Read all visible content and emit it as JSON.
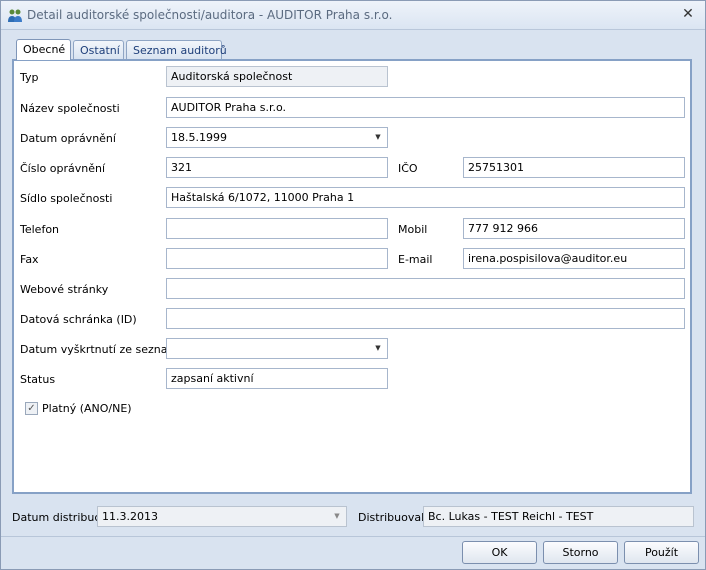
{
  "window": {
    "title": "Detail auditorské společnosti/auditora - AUDITOR Praha s.r.o.",
    "title_icon": "users-icon",
    "close_glyph": "✕"
  },
  "tabs": [
    {
      "label": "Obecné",
      "active": true
    },
    {
      "label": "Ostatní",
      "active": false
    },
    {
      "label": "Seznam auditorů",
      "active": false
    }
  ],
  "form": {
    "typ": {
      "label": "Typ",
      "value": "Auditorská společnost"
    },
    "nazev": {
      "label": "Název společnosti",
      "value": "AUDITOR Praha s.r.o."
    },
    "datum_opravneni": {
      "label": "Datum oprávnění",
      "value": "18.5.1999"
    },
    "cislo_opravneni": {
      "label": "Číslo oprávnění",
      "value": "321"
    },
    "ico": {
      "label": "IČO",
      "value": "25751301"
    },
    "sidlo": {
      "label": "Sídlo společnosti",
      "value": "Haštalská 6/1072, 11000  Praha 1"
    },
    "telefon": {
      "label": "Telefon",
      "value": ""
    },
    "mobil": {
      "label": "Mobil",
      "value": "777 912 966"
    },
    "fax": {
      "label": "Fax",
      "value": ""
    },
    "email": {
      "label": "E-mail",
      "value": "irena.pospisilova@auditor.eu"
    },
    "web": {
      "label": "Webové stránky",
      "value": ""
    },
    "datova_schranka": {
      "label": "Datová schránka (ID)",
      "value": ""
    },
    "datum_vyskrtnuti": {
      "label": "Datum vyškrtnutí ze seznamu",
      "value": ""
    },
    "status": {
      "label": "Status",
      "value": "zapsaní aktivní"
    },
    "platny": {
      "label": "Platný (ANO/NE)",
      "checked": true,
      "check_glyph": "✓"
    }
  },
  "distribution": {
    "datum_label": "Datum distribuce",
    "datum_value": "11.3.2013",
    "distribuoval_label": "Distribuoval",
    "distribuoval_value": "Bc. Lukas - TEST Reichl  - TEST"
  },
  "buttons": {
    "ok": "OK",
    "storno": "Storno",
    "pouzit": "Použít"
  },
  "colors": {
    "window_bg": "#d9e3f0",
    "panel_border": "#86a1c6",
    "tab_text": "#1e3f7a"
  }
}
